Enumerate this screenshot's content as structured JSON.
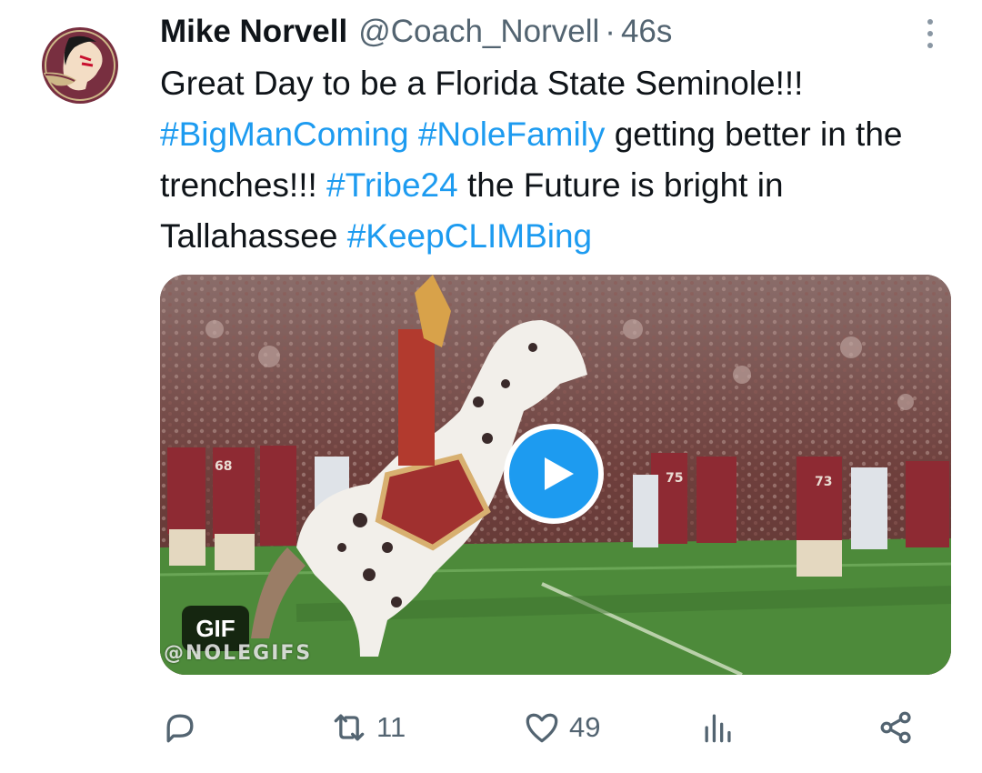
{
  "tweet": {
    "display_name": "Mike Norvell",
    "handle": "@Coach_Norvell",
    "separator": "·",
    "time": "46s",
    "text": {
      "line1": "Great Day to be a Florida State Seminole!!!",
      "hashtag1": "#BigManComing",
      "hashtag2": "#NoleFamily",
      "text2": " getting better in the trenches!!! ",
      "hashtag3": "#Tribe24",
      "text3": " the Future is bright in Tallahassee ",
      "hashtag4": "#KeepCLIMBing"
    },
    "media": {
      "badge": "GIF",
      "watermark": "@NOLEGIFS"
    },
    "stats": {
      "retweets": "11",
      "likes": "49"
    }
  },
  "icons": {
    "avatar": "seminole-logo-icon",
    "more": "more-vertical-icon",
    "play": "play-icon",
    "reply": "reply-icon",
    "retweet": "retweet-icon",
    "like": "heart-icon",
    "views": "views-icon",
    "share": "share-icon"
  },
  "colors": {
    "accent": "#1d9bf0",
    "text": "#0f1419",
    "secondary": "#536471",
    "brand_garnet": "#782f40",
    "brand_gold": "#ceb888"
  }
}
